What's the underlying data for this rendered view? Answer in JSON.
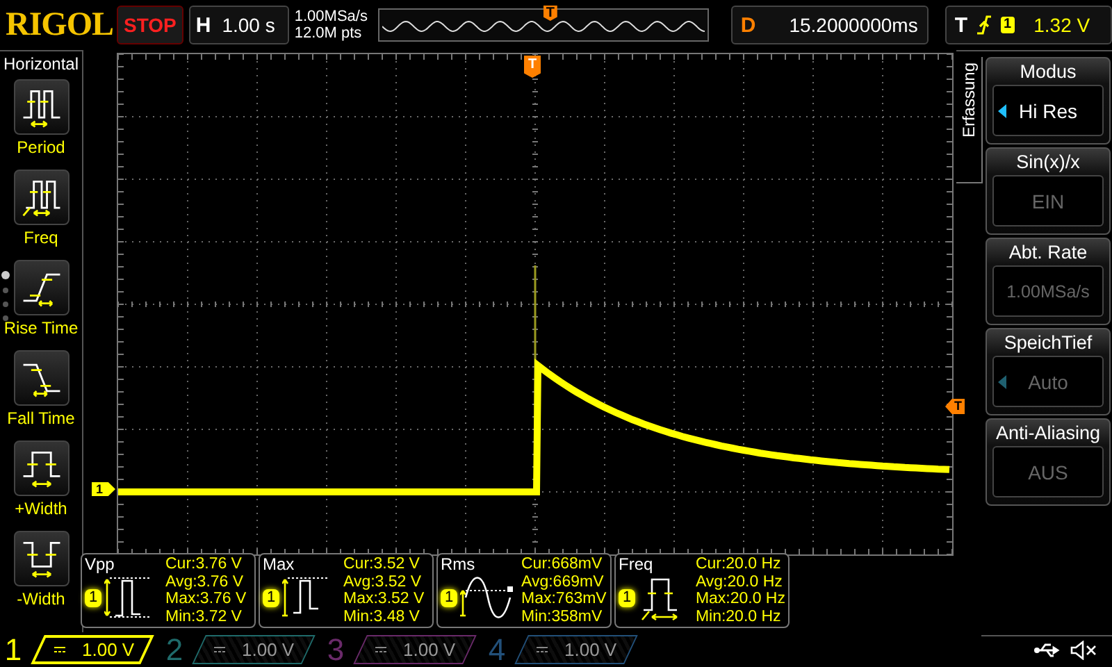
{
  "header": {
    "brand": "RIGOL",
    "run_state": "STOP",
    "timebase_label": "H",
    "timebase": "1.00 s",
    "sample_rate": "1.00MSa/s",
    "memory_depth": "12.0M pts",
    "overview_marker": "T",
    "delay_label": "D",
    "delay": "15.2000000ms",
    "trigger_label": "T",
    "trigger_channel": "1",
    "trigger_level": "1.32 V"
  },
  "left_menu": {
    "title": "Horizontal",
    "items": [
      {
        "label": "Period",
        "kind": "period"
      },
      {
        "label": "Freq",
        "kind": "freq"
      },
      {
        "label": "Rise Time",
        "kind": "rise"
      },
      {
        "label": "Fall Time",
        "kind": "fall"
      },
      {
        "label": "+Width",
        "kind": "pwidth"
      },
      {
        "label": "-Width",
        "kind": "nwidth"
      }
    ],
    "pages": [
      {
        "selected": true
      },
      {
        "selected": false
      },
      {
        "selected": false
      },
      {
        "selected": false
      }
    ]
  },
  "screen": {
    "trigger_position_marker": "T",
    "trigger_level_marker": "T",
    "channel_marker": "1"
  },
  "measurements": [
    {
      "name": "Vpp",
      "channel": "1",
      "kind": "vpp",
      "values": [
        "Cur:3.76 V",
        "Avg:3.76 V",
        "Max:3.76 V",
        "Min:3.72 V"
      ]
    },
    {
      "name": "Max",
      "channel": "1",
      "kind": "max",
      "values": [
        "Cur:3.52 V",
        "Avg:3.52 V",
        "Max:3.52 V",
        "Min:3.48 V"
      ]
    },
    {
      "name": "Rms",
      "channel": "1",
      "kind": "rms",
      "values": [
        "Cur:668mV",
        "Avg:669mV",
        "Max:763mV",
        "Min:358mV"
      ]
    },
    {
      "name": "Freq",
      "channel": "1",
      "kind": "freq",
      "values": [
        "Cur:20.0 Hz",
        "Avg:20.0 Hz",
        "Max:20.0 Hz",
        "Min:20.0 Hz"
      ]
    }
  ],
  "right_menu": {
    "tab": "Erfassung",
    "items": [
      {
        "title": "Modus",
        "value": "Hi Res",
        "disabled": false,
        "arrow": true
      },
      {
        "title": "Sin(x)/x",
        "value": "EIN",
        "disabled": true,
        "arrow": false
      },
      {
        "title": "Abt. Rate",
        "value": "1.00MSa/s",
        "disabled": true,
        "arrow": false
      },
      {
        "title": "SpeichTief",
        "value": "Auto",
        "disabled": true,
        "arrow": true
      },
      {
        "title": "Anti-Aliasing",
        "value": "AUS",
        "disabled": true,
        "arrow": false
      }
    ]
  },
  "channels": [
    {
      "number": "1",
      "scale": "1.00 V",
      "on": true,
      "color": "#ffff00"
    },
    {
      "number": "2",
      "scale": "1.00 V",
      "on": false,
      "color": "#1f6b6b"
    },
    {
      "number": "3",
      "scale": "1.00 V",
      "on": false,
      "color": "#6a2a6a"
    },
    {
      "number": "4",
      "scale": "1.00 V",
      "on": false,
      "color": "#22507a"
    }
  ]
}
